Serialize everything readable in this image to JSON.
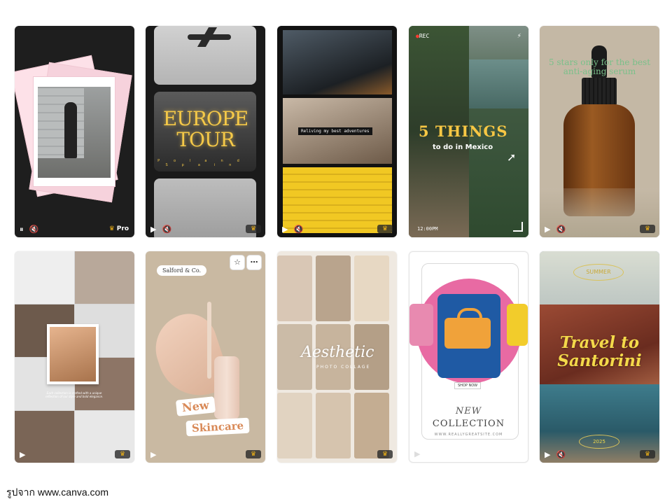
{
  "cards": [
    {
      "name": "Pink polaroid fashion story",
      "pro_label": "Pro"
    },
    {
      "name": "Europe Tour film strip",
      "title_line1": "EUROPE",
      "title_line2": "TOUR",
      "sub_left": "Poland",
      "sub_right": "Spain"
    },
    {
      "name": "Adventures collage",
      "caption": "Reliving my best adventures"
    },
    {
      "name": "5 Things Mexico",
      "rec": "REC",
      "headline": "5 THINGS",
      "subhead": "to do in Mexico",
      "time": "12:00PM"
    },
    {
      "name": "Anti-aging serum",
      "text": "5 stars only for the best anti-aging serum"
    },
    {
      "name": "Grid portrait collage",
      "quote": "Each collection is crafted with a unique reflection of our style and bold elegance."
    },
    {
      "name": "New Skincare",
      "brand": "Salford & Co.",
      "line1": "New",
      "line2": "Skincare"
    },
    {
      "name": "Aesthetic photo collage",
      "title": "Aesthetic",
      "subtitle": "PHOTO COLLAGE"
    },
    {
      "name": "New Collection bag",
      "shop": "SHOP NOW",
      "line1": "NEW",
      "line2": "COLLECTION",
      "site": "WWW.REALLYGREATSITE.COM"
    },
    {
      "name": "Travel to Santorini",
      "season": "SUMMER",
      "line1": "Travel to",
      "line2": "Santorini",
      "year": "2025"
    }
  ],
  "icons": {
    "pause": "⏸",
    "play": "▶",
    "mute": "🔇",
    "crown": "♛",
    "star": "☆",
    "more": "⋯",
    "cursor": "➚",
    "battery": "⚡"
  },
  "credit": "รูปจาก www.canva.com",
  "colors": {
    "accent_gold": "#f2b416",
    "pink": "#e86aa3",
    "blue": "#1f5aa4"
  }
}
